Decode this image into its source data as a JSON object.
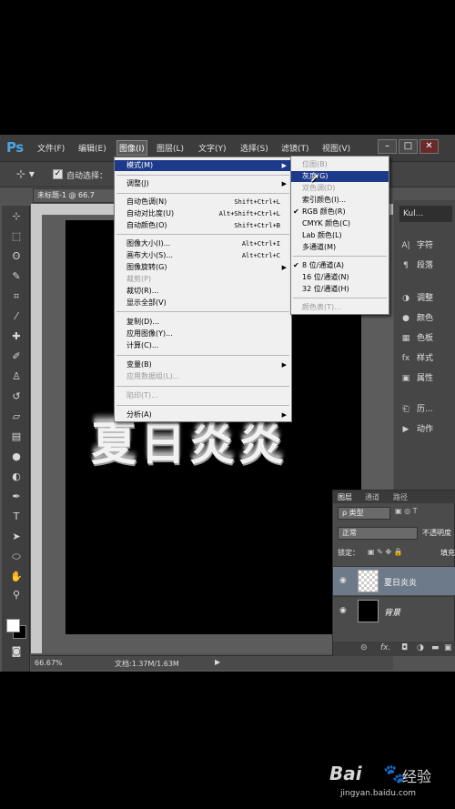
{
  "app": {
    "logo": "Ps"
  },
  "menubar": {
    "items": [
      "文件(F)",
      "编辑(E)",
      "图像(I)",
      "图层(L)",
      "文字(Y)",
      "选择(S)",
      "滤镜(T)",
      "视图(V)"
    ],
    "active_index": 2
  },
  "options": {
    "auto_select_label": "自动选择："
  },
  "document": {
    "tab_title": "未标题-1 @ 66.7"
  },
  "canvas": {
    "text": "夏日炎炎",
    "background": "#000000"
  },
  "status": {
    "zoom": "66.67%",
    "doc_size": "文档:1.37M/1.63M"
  },
  "image_menu": {
    "items": [
      {
        "label": "模式(M)",
        "shortcut": "",
        "submenu": true,
        "highlighted": true
      },
      {
        "label": "调整(J)",
        "shortcut": "",
        "submenu": true
      },
      {
        "label": "自动色调(N)",
        "shortcut": "Shift+Ctrl+L"
      },
      {
        "label": "自动对比度(U)",
        "shortcut": "Alt+Shift+Ctrl+L"
      },
      {
        "label": "自动颜色(O)",
        "shortcut": "Shift+Ctrl+B"
      },
      {
        "label": "图像大小(I)...",
        "shortcut": "Alt+Ctrl+I"
      },
      {
        "label": "画布大小(S)...",
        "shortcut": "Alt+Ctrl+C"
      },
      {
        "label": "图像旋转(G)",
        "shortcut": "",
        "submenu": true
      },
      {
        "label": "裁剪(P)",
        "shortcut": "",
        "disabled": true
      },
      {
        "label": "裁切(R)...",
        "shortcut": ""
      },
      {
        "label": "显示全部(V)",
        "shortcut": ""
      },
      {
        "label": "复制(D)...",
        "shortcut": ""
      },
      {
        "label": "应用图像(Y)...",
        "shortcut": ""
      },
      {
        "label": "计算(C)...",
        "shortcut": ""
      },
      {
        "label": "变量(B)",
        "shortcut": "",
        "submenu": true
      },
      {
        "label": "应用数据组(L)...",
        "shortcut": "",
        "disabled": true
      },
      {
        "label": "陷印(T)...",
        "shortcut": "",
        "disabled": true
      },
      {
        "label": "分析(A)",
        "shortcut": "",
        "submenu": true
      }
    ]
  },
  "mode_submenu": {
    "items": [
      {
        "label": "位图(B)",
        "disabled": true
      },
      {
        "label": "灰度(G)",
        "highlighted": true
      },
      {
        "label": "双色调(D)",
        "disabled": true
      },
      {
        "label": "索引颜色(I)..."
      },
      {
        "label": "RGB 颜色(R)",
        "checked": true
      },
      {
        "label": "CMYK 颜色(C)"
      },
      {
        "label": "Lab 颜色(L)"
      },
      {
        "label": "多通道(M)"
      },
      {
        "label": "8 位/通道(A)",
        "checked": true
      },
      {
        "label": "16 位/通道(N)"
      },
      {
        "label": "32 位/通道(H)"
      },
      {
        "label": "颜色表(T)...",
        "disabled": true
      }
    ]
  },
  "right_panels": {
    "kuler": "Kul...",
    "items": [
      "字符",
      "段落",
      "调整",
      "颜色",
      "色板",
      "样式",
      "属性",
      "历...",
      "动作"
    ]
  },
  "layers_panel": {
    "tabs": [
      "图层",
      "通道",
      "路径"
    ],
    "filter": "ρ 类型",
    "blend_mode": "正常",
    "opacity_label": "不透明度",
    "lock_label": "锁定：",
    "fill_label": "填充",
    "layers": [
      {
        "name": "夏日炎炎",
        "selected": true
      },
      {
        "name": "背景",
        "selected": false
      }
    ]
  },
  "watermark": {
    "brand": "Bai",
    "suffix": "经验",
    "url": "jingyan.baidu.com"
  }
}
